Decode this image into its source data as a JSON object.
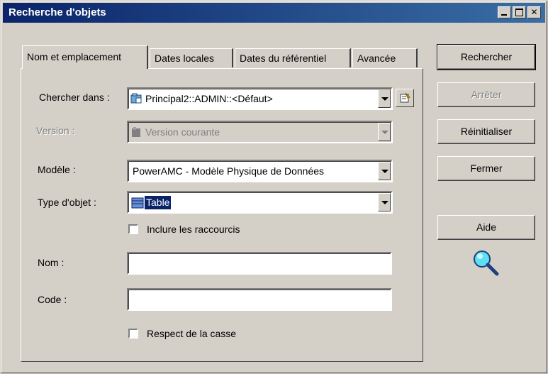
{
  "window": {
    "title": "Recherche d'objets"
  },
  "tabs": [
    {
      "label": "Nom et emplacement",
      "active": true
    },
    {
      "label": "Dates locales",
      "active": false
    },
    {
      "label": "Dates du référentiel",
      "active": false
    },
    {
      "label": "Avancée",
      "active": false
    }
  ],
  "form": {
    "chercher_dans": {
      "label": "Chercher dans :",
      "value": "Principal2::ADMIN::<Défaut>",
      "icon": "repository-folder-icon"
    },
    "version": {
      "label": "Version :",
      "value": "Version courante",
      "disabled": true,
      "icon": "version-icon"
    },
    "modele": {
      "label": "Modèle :",
      "value": "PowerAMC - Modèle Physique de Données"
    },
    "type_objet": {
      "label": "Type d'objet :",
      "value": "Table",
      "icon": "table-icon"
    },
    "inclure_raccourcis": {
      "label": "Inclure les raccourcis",
      "checked": false
    },
    "nom": {
      "label": "Nom :",
      "value": ""
    },
    "code": {
      "label": "Code :",
      "value": ""
    },
    "respect_casse": {
      "label": "Respect de la casse",
      "checked": false
    }
  },
  "buttons": {
    "rechercher": "Rechercher",
    "arreter": "Arrêter",
    "reinitialiser": "Réinitialiser",
    "fermer": "Fermer",
    "aide": "Aide"
  },
  "colors": {
    "title_bar": "#0a246a",
    "face": "#d4d0c8",
    "selection": "#0a246a"
  }
}
